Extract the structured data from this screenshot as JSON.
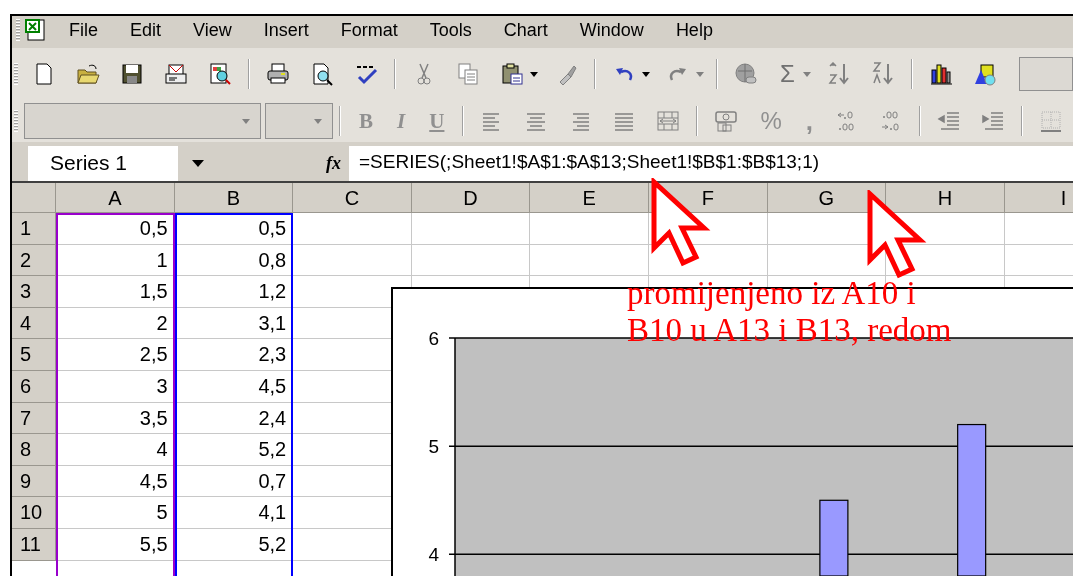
{
  "menu_bar": {
    "items": [
      "File",
      "Edit",
      "View",
      "Insert",
      "Format",
      "Tools",
      "Chart",
      "Window",
      "Help"
    ]
  },
  "standard_toolbar": {
    "autosum": "Σ"
  },
  "formatting_toolbar": {
    "disabled": true,
    "bold": "B",
    "italic": "I",
    "underline": "U",
    "percent": "%",
    "comma": ","
  },
  "formula_bar": {
    "name_box": "Series 1",
    "fx": "fx",
    "formula": "=SERIES(;Sheet1!$A$1:$A$13;Sheet1!$B$1:$B$13;1)"
  },
  "sheet": {
    "columns": [
      {
        "label": "A",
        "color": "#9900cc"
      },
      {
        "label": "B",
        "color": "#0000ff"
      },
      {
        "label": "C"
      },
      {
        "label": "D"
      },
      {
        "label": "E"
      },
      {
        "label": "F"
      },
      {
        "label": "G"
      },
      {
        "label": "H"
      },
      {
        "label": "I"
      }
    ],
    "rows": [
      {
        "label": "1",
        "cells": [
          "0,5",
          "0,5"
        ]
      },
      {
        "label": "2",
        "cells": [
          "1",
          "0,8"
        ]
      },
      {
        "label": "3",
        "cells": [
          "1,5",
          "1,2"
        ]
      },
      {
        "label": "4",
        "cells": [
          "2",
          "3,1"
        ]
      },
      {
        "label": "5",
        "cells": [
          "2,5",
          "2,3"
        ]
      },
      {
        "label": "6",
        "cells": [
          "3",
          "4,5"
        ]
      },
      {
        "label": "7",
        "cells": [
          "3,5",
          "2,4"
        ]
      },
      {
        "label": "8",
        "cells": [
          "4",
          "5,2"
        ]
      },
      {
        "label": "9",
        "cells": [
          "4,5",
          "0,7"
        ]
      },
      {
        "label": "10",
        "cells": [
          "5",
          "4,1"
        ]
      },
      {
        "label": "11",
        "cells": [
          "5,5",
          "5,2"
        ]
      }
    ]
  },
  "chart": {
    "chart_data": {
      "type": "bar",
      "ylim": [
        3.8,
        6
      ],
      "yticks": [
        4,
        5,
        6
      ],
      "series": [
        {
          "color": "#9999ff",
          "values": [
            null,
            null,
            null,
            null,
            null,
            4.5,
            null,
            5.2,
            null
          ]
        }
      ]
    }
  },
  "annotation": {
    "text": "promijenjeno iz A10 i\nB10 u A13 i B13, redom",
    "color": "#ff0000"
  }
}
